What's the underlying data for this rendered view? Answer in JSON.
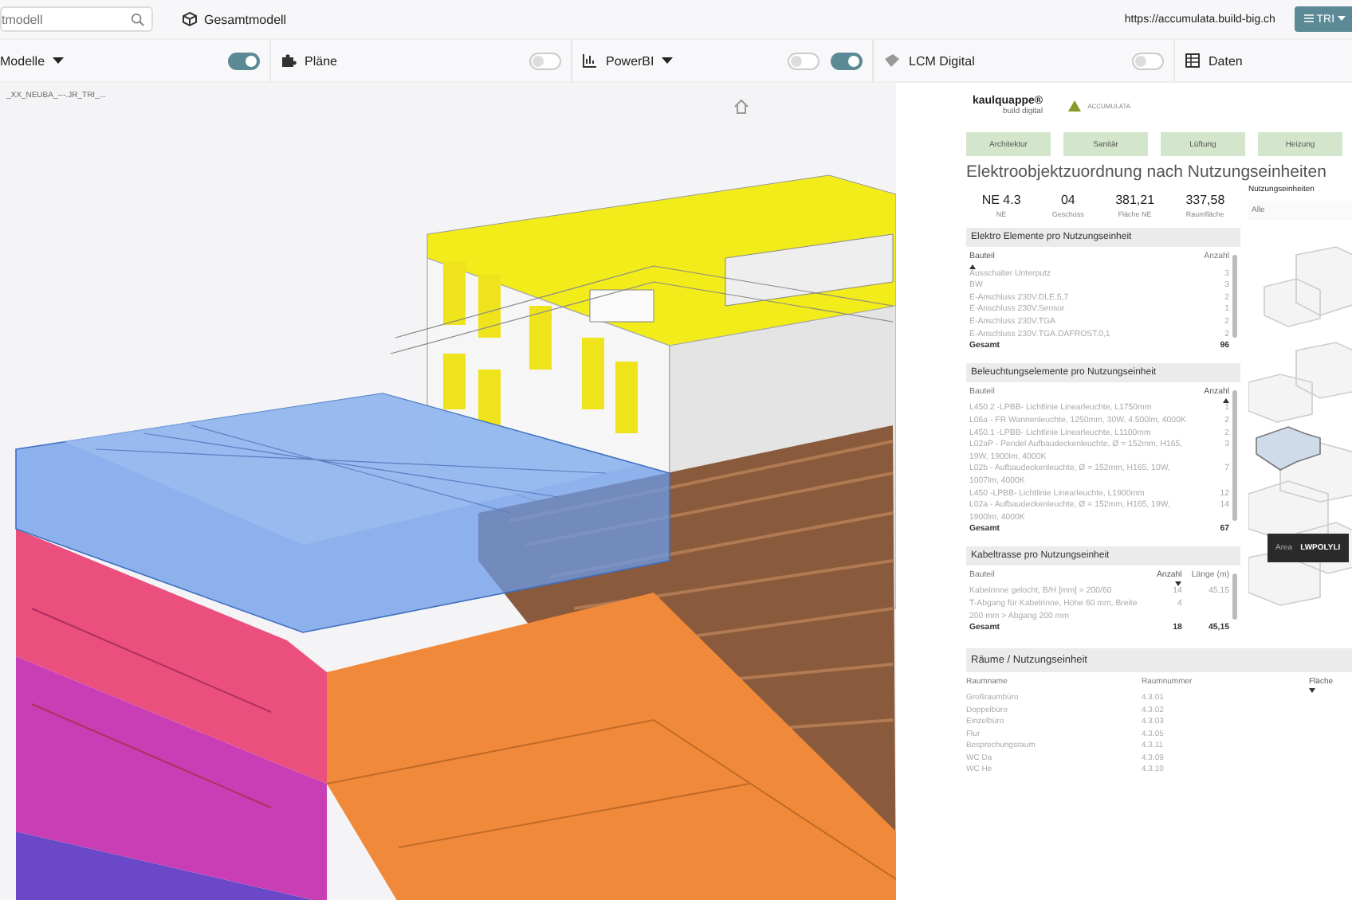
{
  "top_bar": {
    "search": {
      "placeholder": "tmodell"
    },
    "model_name": "Gesamtmodell",
    "url": "https://accumulata.build-big.ch",
    "user_button": "TRI"
  },
  "toolbar": [
    {
      "kind": "dropdown",
      "label": "Modelle",
      "toggles": [
        {
          "on": true
        }
      ]
    },
    {
      "kind": "plain",
      "label": "Pläne",
      "toggles": [
        {
          "on": false
        }
      ]
    },
    {
      "kind": "dropdown",
      "label": "PowerBI",
      "toggles": [
        {
          "on": false
        },
        {
          "on": true
        }
      ]
    },
    {
      "kind": "plain",
      "label": "LCM Digital",
      "toggles": [
        {
          "on": false
        }
      ]
    },
    {
      "kind": "plain",
      "label": "Daten"
    }
  ],
  "viewport": {
    "file_label": "_XX_NEUBA_---.JR_TRI_..."
  },
  "panel": {
    "logo": "kaulquappe®",
    "logo_subtitle": "build digital",
    "partner_logo": "ACCUMULATA",
    "filter_buttons": [
      "Architektur",
      "Sanitär",
      "Lüftung",
      "Heizung"
    ],
    "title": "Elektroobjektzuordnung nach Nutzungseinheiten",
    "stats": [
      {
        "value": "NE 4.3",
        "label": "NE"
      },
      {
        "value": "04",
        "label": "Geschoss"
      },
      {
        "value": "381,21",
        "label": "Fläche NE"
      },
      {
        "value": "337,58",
        "label": "Raumfläche"
      }
    ],
    "unit_filter": {
      "label": "Nutzungseinheiten",
      "value": "Alle"
    },
    "tables": [
      {
        "title": "Elektro Elemente pro Nutzungseinheit",
        "columns": [
          {
            "label": "Bauteil",
            "sorted": true,
            "descending": false
          },
          {
            "label": "Anzahl",
            "sorted": false
          }
        ],
        "rows": [
          [
            "Ausschalter Unterputz",
            "3"
          ],
          [
            "BW",
            "3"
          ],
          [
            "E-Anschluss 230V.DLE.5,7",
            "2"
          ],
          [
            "E-Anschluss 230V.Sensor",
            "1"
          ],
          [
            "E-Anschluss 230V.TGA",
            "2"
          ],
          [
            "E-Anschluss 230V.TGA.DAFROST.0,1",
            "2"
          ]
        ],
        "total": [
          "Gesamt",
          "96"
        ]
      },
      {
        "title": "Beleuchtungselemente pro Nutzungseinheit",
        "columns": [
          {
            "label": "Bauteil",
            "sorted": false
          },
          {
            "label": "Anzahl",
            "sorted": true,
            "descending": false
          }
        ],
        "rows": [
          [
            "L450.2 -LPBB- Lichtlinie Linearleuchte, L1750mm",
            "1"
          ],
          [
            "L06a - FR Wannenleuchte, 1250mm, 30W, 4.500lm, 4000K",
            "2"
          ],
          [
            "L450.1 -LPBB- Lichtlinie Linearleuchte, L1100mm",
            "2"
          ],
          [
            "L02aP - Pendel Aufbaudeckenleuchte, Ø = 152mm, H165, 19W, 1900lm, 4000K",
            "3"
          ],
          [
            "L02b - Aufbaudeckenleuchte, Ø = 152mm, H165, 10W, 1007lm, 4000K",
            "7"
          ],
          [
            "L450 -LPBB- Lichtlinie Linearleuchte, L1900mm",
            "12"
          ],
          [
            "L02a - Aufbaudeckenleuchte, Ø = 152mm, H165, 19W, 1900lm, 4000K",
            "14"
          ]
        ],
        "total": [
          "Gesamt",
          "67"
        ]
      },
      {
        "title": "Kabeltrasse pro Nutzungseinheit",
        "columns": [
          {
            "label": "Bauteil",
            "sorted": false
          },
          {
            "label": "Anzahl",
            "sorted": true,
            "descending": true
          },
          {
            "label": "Länge (m)",
            "sorted": false
          }
        ],
        "rows": [
          [
            "Kabelrinne gelocht, B/H [mm] = 200/60",
            "14",
            "45,15"
          ],
          [
            "T-Abgang für Kabelrinne, Höhe 60 mm, Breite 200 mm > Abgang 200 mm",
            "4",
            ""
          ]
        ],
        "total": [
          "Gesamt",
          "18",
          "45,15"
        ]
      }
    ],
    "rooms": {
      "title": "Räume / Nutzungseinheit",
      "columns": [
        {
          "label": "Raumname",
          "sorted": false
        },
        {
          "label": "Raumnummer",
          "sorted": false
        },
        {
          "label": "Fläche",
          "sorted": true,
          "descending": true
        }
      ],
      "rows": [
        [
          "Großraumbüro",
          "4.3.01"
        ],
        [
          "Doppelbüro",
          "4.3.02"
        ],
        [
          "Einzelbüro",
          "4.3.03"
        ],
        [
          "Flur",
          "4.3.05"
        ],
        [
          "Besprechungsraum",
          "4.3.11"
        ],
        [
          "WC Da",
          "4.3.09"
        ],
        [
          "WC He",
          "4.3.10"
        ]
      ]
    },
    "tooltip": {
      "label": "Area",
      "value": "LWPOLYLI"
    }
  }
}
